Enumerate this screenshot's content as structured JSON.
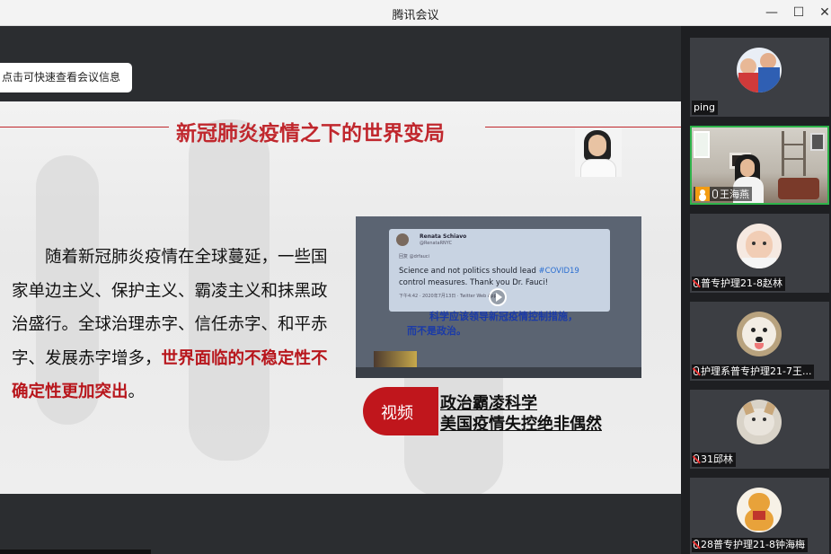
{
  "window": {
    "title": "腾讯会议",
    "minimize": "—",
    "maximize": "☐",
    "close": "✕"
  },
  "meeting_info_button": "点击可快速查看会议信息",
  "slide": {
    "title": "新冠肺炎疫情之下的世界变局",
    "paragraph_normal": "随着新冠肺炎疫情在全球蔓延，一些国家单边主义、保护主义、霸凌主义和抹黑政治盛行。全球治理赤字、信任赤字、和平赤字、发展赤字增多，",
    "paragraph_highlight": "世界面临的不稳定性不确定性更加突出",
    "paragraph_end": "。",
    "video": {
      "tweet_name": "Renata Schiavo",
      "tweet_handle": "@RenataRNYC",
      "tweet_reply": "回复 @drfauci",
      "tweet_text_before": "Science and not politics should lead ",
      "tweet_tag": "#COVID19",
      "tweet_text_after": " control measures. Thank you Dr. Fauci!",
      "tweet_meta": "下午4:42 · 2020年7月13日 · Twitter Web App",
      "subtitle_1": "科学应该领导新冠疫情控制措施，",
      "subtitle_2": "而不是政治。"
    },
    "video_badge": "视频",
    "caption_1": "政治霸凌科学",
    "caption_2": "美国疫情失控绝非偶然"
  },
  "participants": [
    {
      "name": "ping",
      "muted": false,
      "avatar": "kids-photo"
    },
    {
      "name": "王海燕",
      "muted": false,
      "host": true,
      "active": true,
      "avatar": "video-feed"
    },
    {
      "name": "普专护理21-8赵林",
      "muted": true,
      "avatar": "baby-photo"
    },
    {
      "name": "护理系普专护理21-7王...",
      "muted": true,
      "avatar": "dog-photo"
    },
    {
      "name": "31邱林",
      "muted": true,
      "avatar": "cat-photo"
    },
    {
      "name": "28普专护理21-8钟海梅",
      "muted": true,
      "avatar": "bear-photo"
    }
  ],
  "colors": {
    "accent_red": "#c0272d",
    "active_border": "#2eb34a",
    "host_badge": "#f39c12"
  }
}
